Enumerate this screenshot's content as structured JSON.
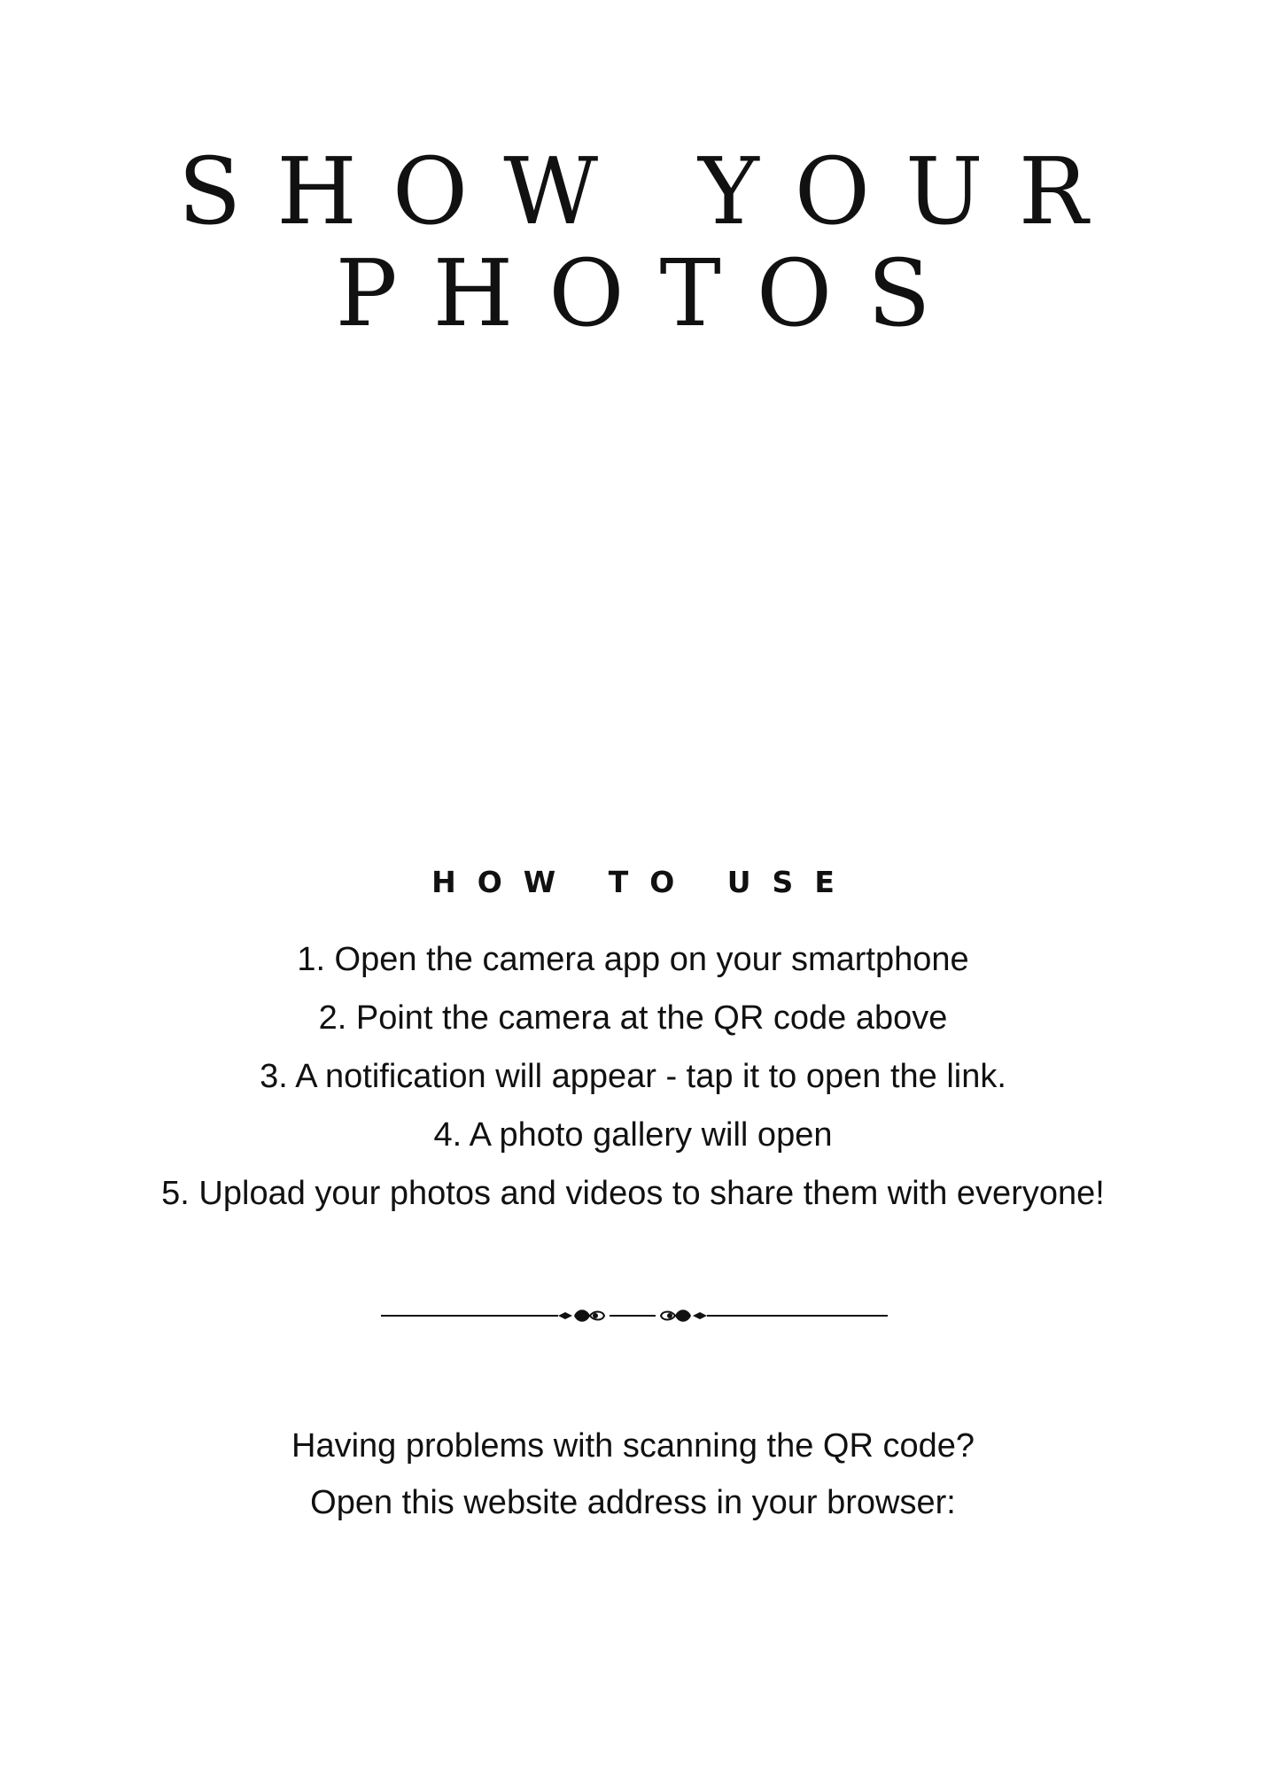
{
  "title": {
    "line1": "SHOW YOUR",
    "line2": "PHOTOS"
  },
  "how_to_use": {
    "heading": "HOW TO USE",
    "steps": [
      "1. Open the camera app on your smartphone",
      "2. Point the camera at the QR code above",
      "3. A notification will appear - tap it to open the link.",
      "4. A photo gallery will open",
      "5. Upload your photos and videos to share them with everyone!"
    ]
  },
  "help": {
    "line1": "Having problems with scanning the QR code?",
    "line2": "Open this website address in your browser:"
  },
  "colors": {
    "background": "#ffffff",
    "text": "#111111"
  },
  "icons": {
    "divider": "ornamental-flourish-divider"
  }
}
